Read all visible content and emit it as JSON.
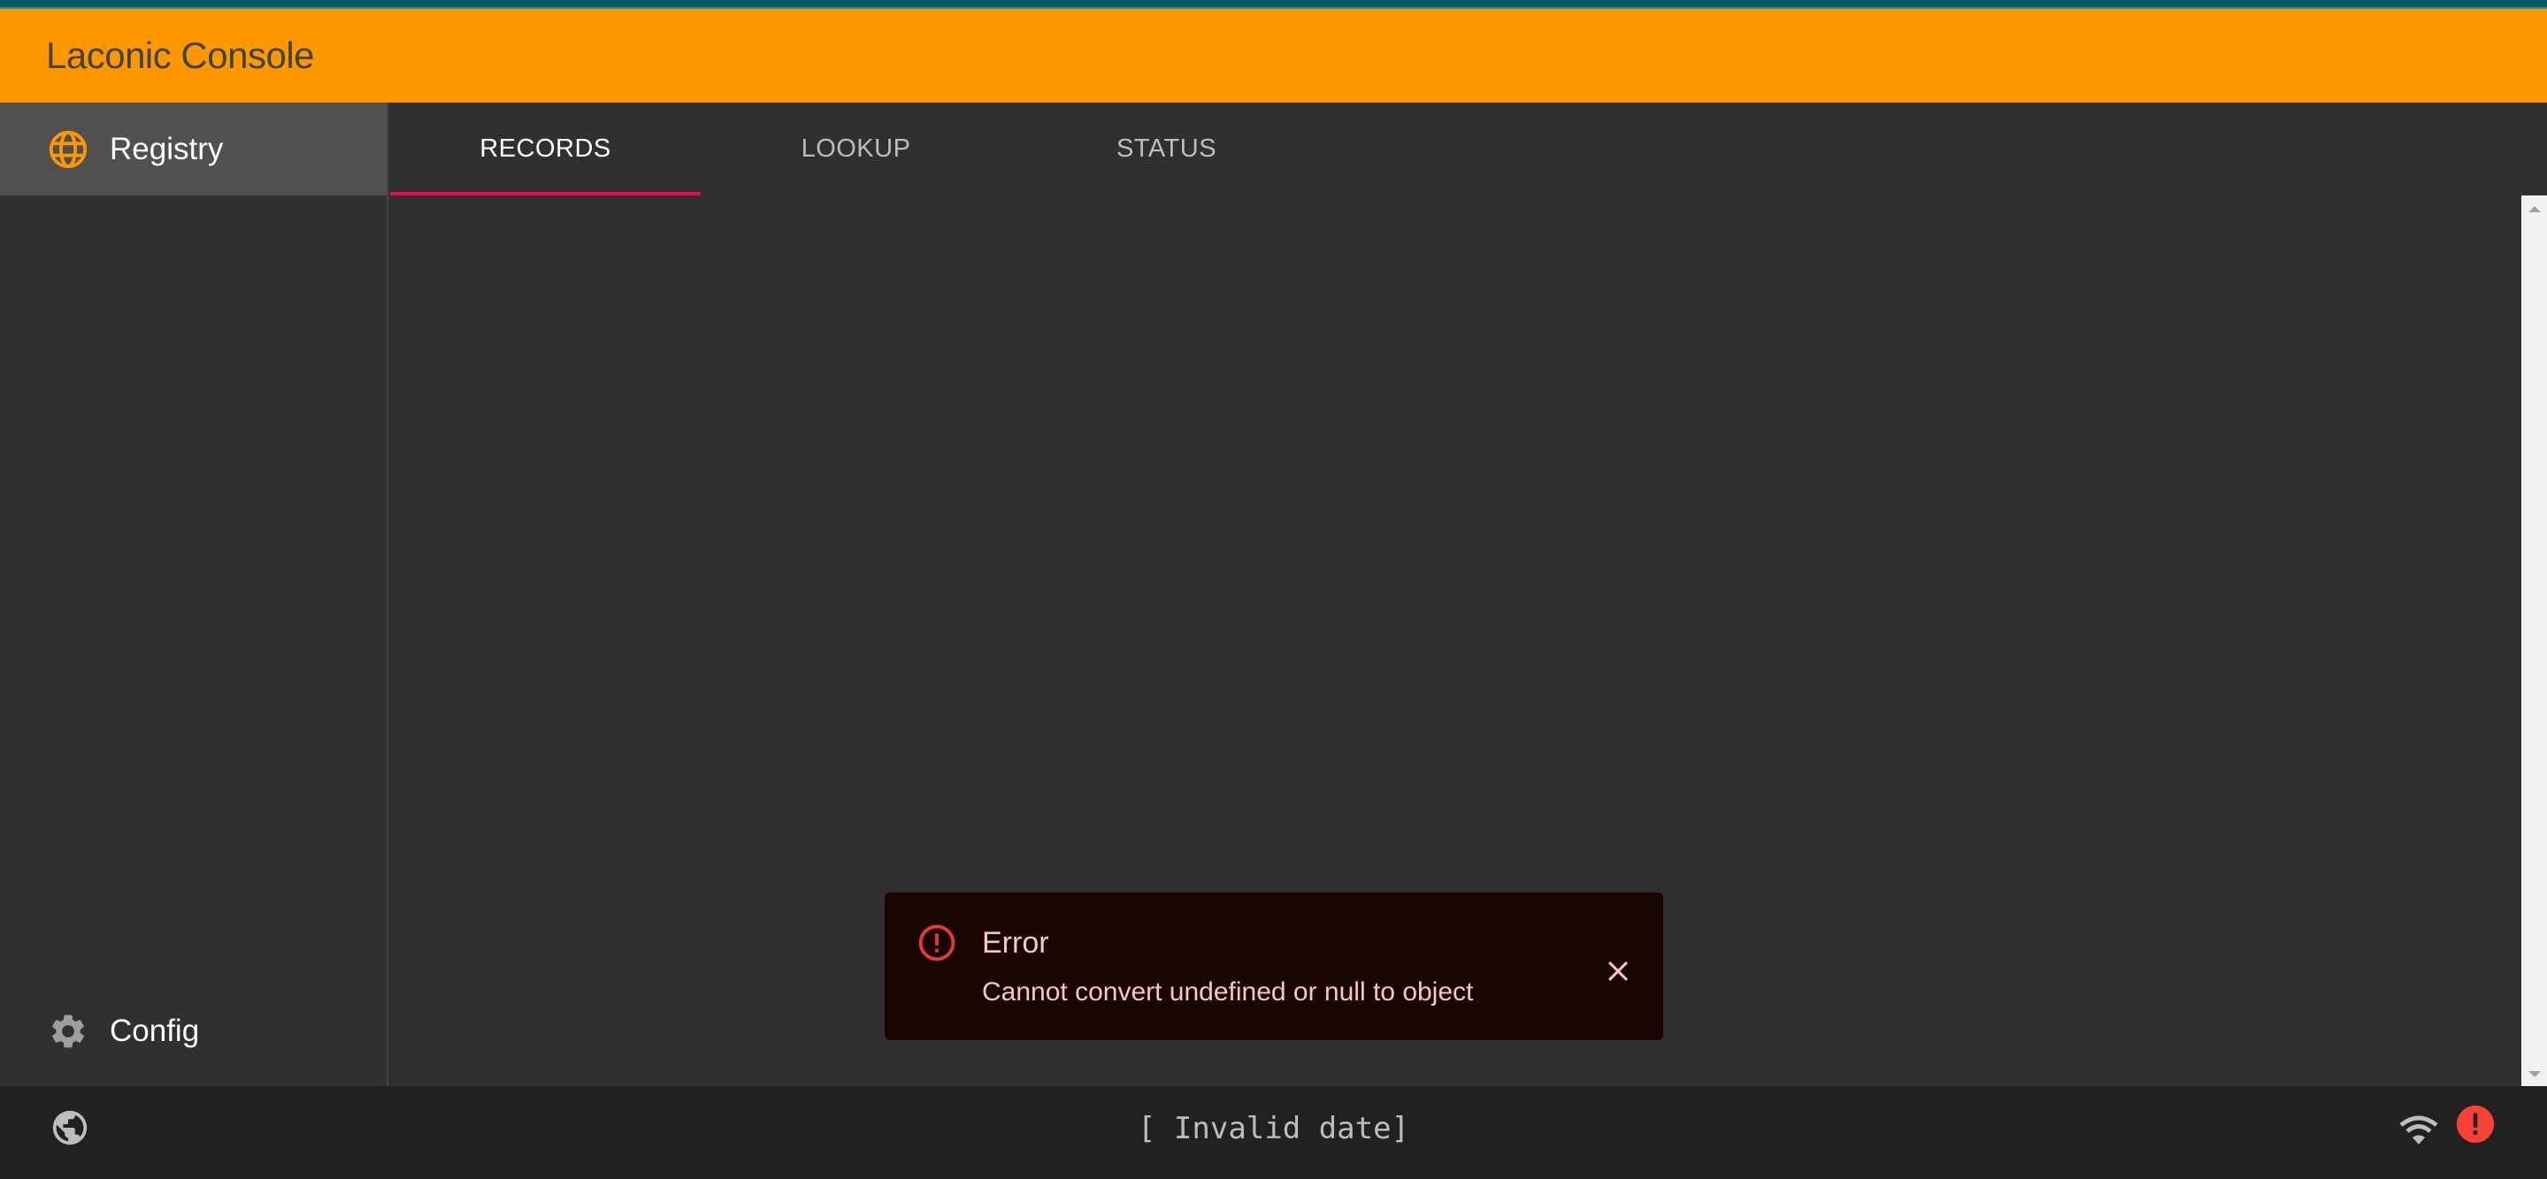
{
  "app": {
    "title": "Laconic Console"
  },
  "sidebar": {
    "items": [
      {
        "label": "Registry",
        "icon": "globe-icon",
        "active": true
      },
      {
        "label": "Config",
        "icon": "gear-icon",
        "active": false
      }
    ]
  },
  "tabs": [
    {
      "label": "RECORDS",
      "active": true
    },
    {
      "label": "LOOKUP",
      "active": false
    },
    {
      "label": "STATUS",
      "active": false
    }
  ],
  "toast": {
    "type": "error",
    "title": "Error",
    "message": "Cannot convert undefined or null to object",
    "icon": "error-outline-icon",
    "close_icon": "close-icon"
  },
  "status_bar": {
    "left_icon": "public-globe-icon",
    "date_text": "[ Invalid date]",
    "right_icons": [
      "wifi-icon",
      "error-icon"
    ]
  },
  "colors": {
    "header": "#ff9800",
    "accent": "#f50057",
    "error": "#f44336",
    "background": "#303030"
  }
}
